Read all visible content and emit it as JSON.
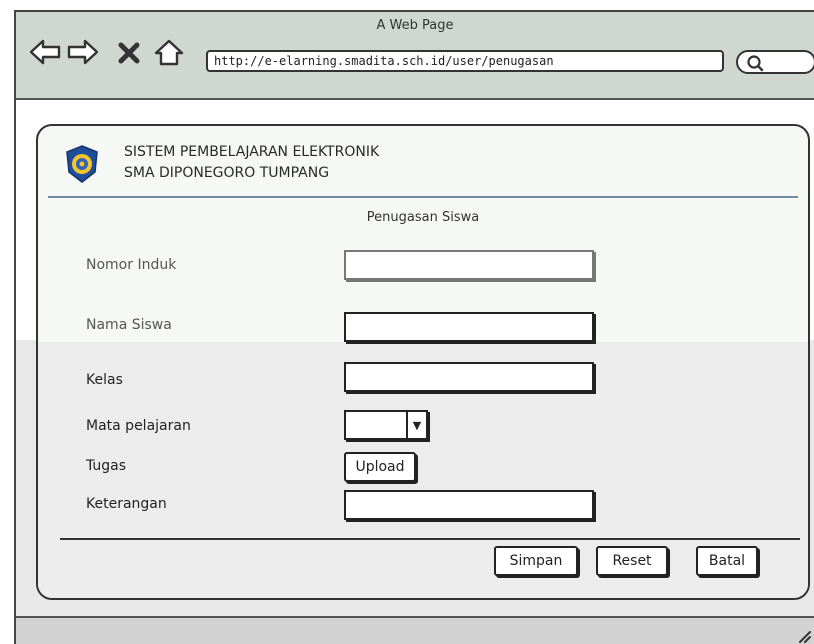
{
  "browser": {
    "title": "A Web Page",
    "url": "http://e-elarning.smadita.sch.id/user/penugasan"
  },
  "header": {
    "line1": "SISTEM PEMBELAJARAN ELEKTRONIK",
    "line2": "SMA DIPONEGORO TUMPANG"
  },
  "form": {
    "title": "Penugasan Siswa",
    "fields": {
      "nomor_induk": {
        "label": "Nomor Induk",
        "value": ""
      },
      "nama_siswa": {
        "label": "Nama Siswa",
        "value": ""
      },
      "kelas": {
        "label": "Kelas",
        "value": ""
      },
      "mata_pelajaran": {
        "label": "Mata pelajaran",
        "value": ""
      },
      "tugas": {
        "label": "Tugas",
        "button": "Upload"
      },
      "keterangan": {
        "label": "Keterangan",
        "value": ""
      }
    },
    "buttons": {
      "save": "Simpan",
      "reset": "Reset",
      "cancel": "Batal"
    }
  }
}
